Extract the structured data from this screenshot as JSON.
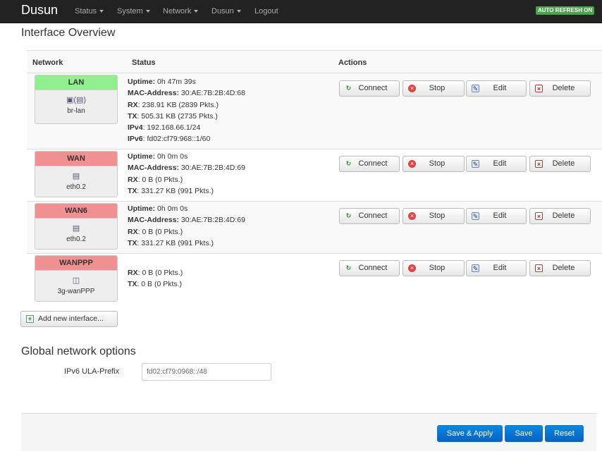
{
  "navbar": {
    "brand": "Dusun",
    "menus": [
      "Status",
      "System",
      "Network",
      "Dusun"
    ],
    "logout": "Logout",
    "auto_refresh": "AUTO REFRESH ON"
  },
  "overview": {
    "title": "Interface Overview",
    "columns": {
      "network": "Network",
      "status": "Status",
      "actions": "Actions"
    },
    "actions": {
      "connect": "Connect",
      "stop": "Stop",
      "edit": "Edit",
      "delete": "Delete"
    },
    "interfaces": [
      {
        "name": "LAN",
        "state_color": "#90f090",
        "icon": "bridge-network-icon",
        "device": "br-lan",
        "status": [
          {
            "label": "Uptime",
            "value": "0h 47m 39s"
          },
          {
            "label": "MAC-Address",
            "value": "30:AE:7B:2B:4D:68"
          },
          {
            "label": "RX",
            "value": "238.91 KB (2839 Pkts.)"
          },
          {
            "label": "TX",
            "value": "505.31 KB (2735 Pkts.)"
          },
          {
            "label": "IPv4",
            "value": "192.168.66.1/24"
          },
          {
            "label": "IPv6",
            "value": "fd02:cf79:968::1/60"
          }
        ]
      },
      {
        "name": "WAN",
        "state_color": "#f09090",
        "icon": "ethernet-icon",
        "device": "eth0.2",
        "status": [
          {
            "label": "Uptime",
            "value": "0h 0m 0s"
          },
          {
            "label": "MAC-Address",
            "value": "30:AE:7B:2B:4D:69"
          },
          {
            "label": "RX",
            "value": "0 B (0 Pkts.)"
          },
          {
            "label": "TX",
            "value": "331.27 KB (991 Pkts.)"
          }
        ]
      },
      {
        "name": "WAN6",
        "state_color": "#f09090",
        "icon": "ethernet-icon",
        "device": "eth0.2",
        "status": [
          {
            "label": "Uptime",
            "value": "0h 0m 0s"
          },
          {
            "label": "MAC-Address",
            "value": "30:AE:7B:2B:4D:69"
          },
          {
            "label": "RX",
            "value": "0 B (0 Pkts.)"
          },
          {
            "label": "TX",
            "value": "331.27 KB (991 Pkts.)"
          }
        ]
      },
      {
        "name": "WANPPP",
        "state_color": "#f09090",
        "icon": "ppp-device-icon",
        "device": "3g-wanPPP",
        "status": [
          {
            "label": "RX",
            "value": "0 B (0 Pkts.)"
          },
          {
            "label": "TX",
            "value": "0 B (0 Pkts.)"
          }
        ]
      }
    ],
    "add_button": "Add new interface..."
  },
  "global": {
    "title": "Global network options",
    "ula_label": "IPv6 ULA-Prefix",
    "ula_value": "fd02:cf79:0968::/48"
  },
  "footer": {
    "save_apply": "Save & Apply",
    "save": "Save",
    "reset": "Reset"
  }
}
